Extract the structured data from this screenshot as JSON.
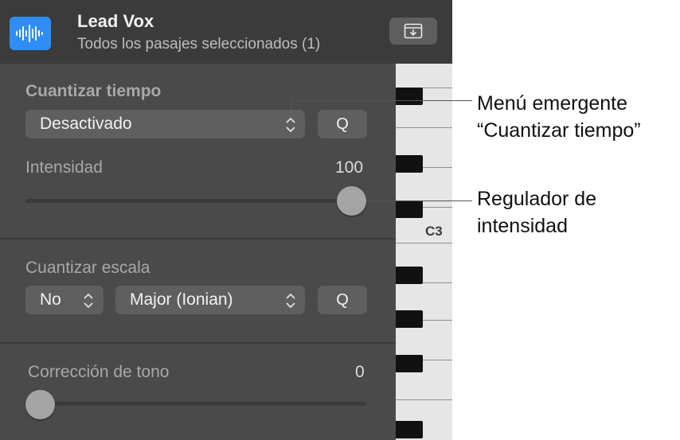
{
  "header": {
    "track_name": "Lead Vox",
    "subtitle": "Todos los pasajes seleccionados (1)",
    "icons": {
      "region": "audio-waveform-icon",
      "action": "download-tray-icon"
    }
  },
  "time_quantize": {
    "title": "Cuantizar tiempo",
    "popup_value": "Desactivado",
    "q_label": "Q",
    "strength_label": "Intensidad",
    "strength_value": "100",
    "strength_level": 1.0
  },
  "scale_quantize": {
    "title": "Cuantizar escala",
    "key_value": "No",
    "scale_value": "Major (Ionian)",
    "q_label": "Q"
  },
  "pitch_correction": {
    "title": "Corrección de tono",
    "value": "0",
    "level": 0.0
  },
  "piano": {
    "c3_label": "C3"
  },
  "callouts": {
    "popup_line1": "Menú emergente",
    "popup_line2": "“Cuantizar tiempo”",
    "slider_line1": "Regulador de",
    "slider_line2": "intensidad"
  },
  "colors": {
    "accent": "#2f8ef5",
    "panel": "#4a4a4a",
    "header": "#3b3b3b"
  }
}
